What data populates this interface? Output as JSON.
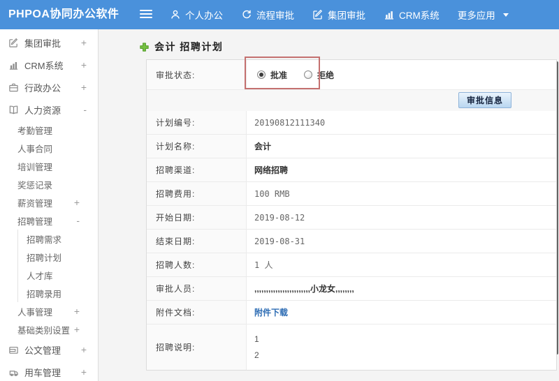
{
  "colors": {
    "topbar_bg": "#4a91db",
    "annotation_red": "#c4706f",
    "link_blue": "#2e6db4",
    "plus_green": "#76c043",
    "button_face": "#bad7f1",
    "scrollbar_thumb": "#636363"
  },
  "topbar": {
    "brand": "PHPOA协同办公软件",
    "menu_toggle_icon": "hamburger-icon",
    "menu": [
      {
        "label": "个人办公",
        "icon": "person-icon",
        "caret": false
      },
      {
        "label": "流程审批",
        "icon": "cycle-icon",
        "caret": false
      },
      {
        "label": "集团审批",
        "icon": "edit-icon",
        "caret": false
      },
      {
        "label": "CRM系统",
        "icon": "chart-icon",
        "caret": false
      },
      {
        "label": "更多应用",
        "icon": "",
        "caret": true
      }
    ]
  },
  "sidebar": {
    "items": [
      {
        "label": "集团审批",
        "icon": "edit-icon",
        "toggle": "+",
        "level": 0
      },
      {
        "label": "CRM系统",
        "icon": "chart-icon",
        "toggle": "+",
        "level": 0
      },
      {
        "label": "行政办公",
        "icon": "briefcase-icon",
        "toggle": "+",
        "level": 0
      },
      {
        "label": "人力资源",
        "icon": "book-icon",
        "toggle": "-",
        "level": 0
      },
      {
        "label": "考勤管理",
        "icon": "",
        "toggle": "",
        "level": 1
      },
      {
        "label": "人事合同",
        "icon": "",
        "toggle": "",
        "level": 1
      },
      {
        "label": "培训管理",
        "icon": "",
        "toggle": "",
        "level": 1
      },
      {
        "label": "奖惩记录",
        "icon": "",
        "toggle": "",
        "level": 1
      },
      {
        "label": "薪资管理",
        "icon": "",
        "toggle": "+",
        "level": 1
      },
      {
        "label": "招聘管理",
        "icon": "",
        "toggle": "-",
        "level": 1
      },
      {
        "label": "招聘需求",
        "icon": "",
        "toggle": "",
        "level": 2
      },
      {
        "label": "招聘计划",
        "icon": "",
        "toggle": "",
        "level": 2
      },
      {
        "label": "人才库",
        "icon": "",
        "toggle": "",
        "level": 2
      },
      {
        "label": "招聘录用",
        "icon": "",
        "toggle": "",
        "level": 2
      },
      {
        "label": "人事管理",
        "icon": "",
        "toggle": "+",
        "level": 1
      },
      {
        "label": "基础类别设置",
        "icon": "",
        "toggle": "+",
        "level": 1
      },
      {
        "label": "公文管理",
        "icon": "wallet-icon",
        "toggle": "+",
        "level": 0
      },
      {
        "label": "用车管理",
        "icon": "car-icon",
        "toggle": "+",
        "level": 0
      }
    ]
  },
  "content": {
    "title_icon": "add-plus-icon",
    "title": "会计 招聘计划",
    "approval": {
      "label": "审批状态:",
      "options": [
        {
          "label": "批准",
          "selected": true
        },
        {
          "label": "拒绝",
          "selected": false
        }
      ],
      "button_label": "审批信息"
    },
    "fields": [
      {
        "label": "计划编号:",
        "value": "20190812111340",
        "style": "mono"
      },
      {
        "label": "计划名称:",
        "value": "会计",
        "style": "bold"
      },
      {
        "label": "招聘渠道:",
        "value": "网络招聘",
        "style": "bold"
      },
      {
        "label": "招聘费用:",
        "value": "100 RMB",
        "style": "mono"
      },
      {
        "label": "开始日期:",
        "value": "2019-08-12",
        "style": "mono"
      },
      {
        "label": "结束日期:",
        "value": "2019-08-31",
        "style": "mono"
      },
      {
        "label": "招聘人数:",
        "value": "1 人",
        "style": "mono"
      },
      {
        "label": "审批人员:",
        "value": ",,,,,,,,,,,,,,,,,,,,,,,,小龙女,,,,,,,,",
        "style": "bold"
      },
      {
        "label": "附件文档:",
        "value": "附件下载",
        "style": "link"
      },
      {
        "label": "招聘说明:",
        "lines": [
          "1",
          "2"
        ],
        "style": "multiline"
      }
    ]
  }
}
